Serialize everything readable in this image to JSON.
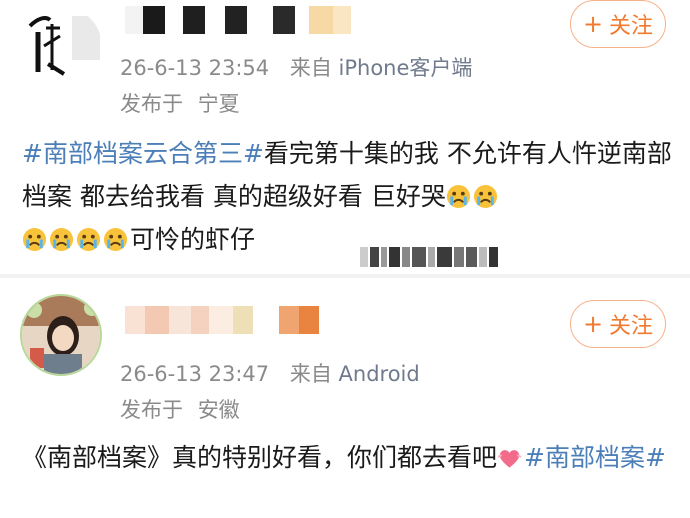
{
  "posts": [
    {
      "follow_label": "关注",
      "follow_plus": "+",
      "timestamp": "26-6-13 23:54",
      "source_prefix": "来自",
      "source_device": "iPhone客户端",
      "location_prefix": "发布于",
      "location": "宁夏",
      "content": {
        "hashtag": "#南部档案云合第三#",
        "text1": "看完第十集的我 不允许有人忤逆南部档案  都去给我看 真的超级好看 巨好哭",
        "text2": "可怜的虾仔"
      }
    },
    {
      "follow_label": "关注",
      "follow_plus": "+",
      "timestamp": "26-6-13 23:47",
      "source_prefix": "来自",
      "source_device": "Android",
      "location_prefix": "发布于",
      "location": "安徽",
      "content": {
        "text1": "《南部档案》真的特别好看，你们都去看吧",
        "hashtag": "#南部档案#"
      }
    }
  ],
  "icons": {
    "crying": "crying-emoji-icon",
    "heart": "heart-emoji-icon"
  },
  "colors": {
    "accent": "#f07a2f",
    "hashtag": "#4c7fb8",
    "meta": "#8a8a8a"
  }
}
